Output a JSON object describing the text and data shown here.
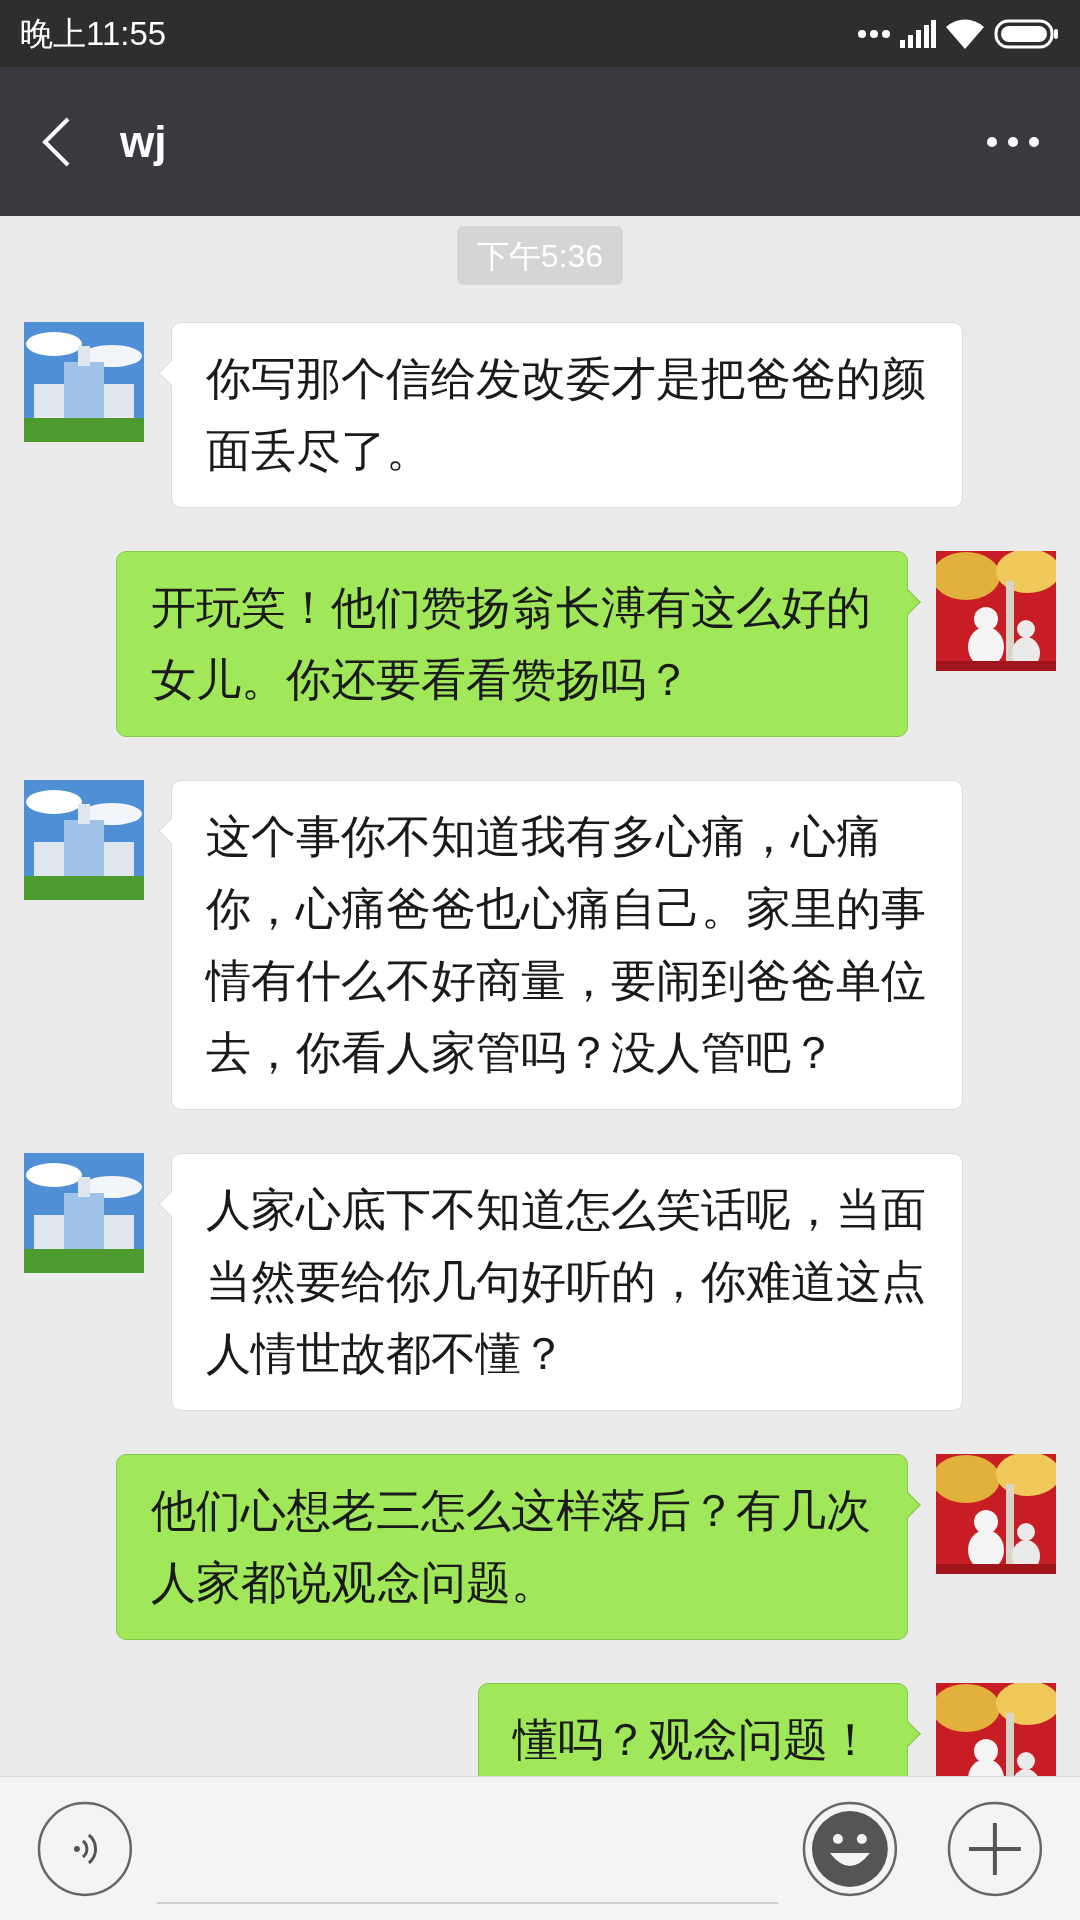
{
  "status_bar": {
    "time": "晚上11:55"
  },
  "header": {
    "title": "wj"
  },
  "time_label": "下午5:36",
  "messages": [
    {
      "kind": "received",
      "text": "你写那个信给发改委才是把爸爸的颜面丢尽了。"
    },
    {
      "kind": "sent",
      "text": "开玩笑！他们赞扬翁长溥有这么好的女儿。你还要看看赞扬吗？"
    },
    {
      "kind": "received",
      "text": "这个事你不知道我有多心痛，心痛你，心痛爸爸也心痛自己。家里的事情有什么不好商量，要闹到爸爸单位去，你看人家管吗？没人管吧？"
    },
    {
      "kind": "received",
      "text": "人家心底下不知道怎么笑话呢，当面当然要给你几句好听的，你难道这点人情世故都不懂？"
    },
    {
      "kind": "sent",
      "text": "他们心想老三怎么这样落后？有几次人家都说观念问题。"
    },
    {
      "kind": "sent",
      "text": "懂吗？观念问题！"
    }
  ]
}
